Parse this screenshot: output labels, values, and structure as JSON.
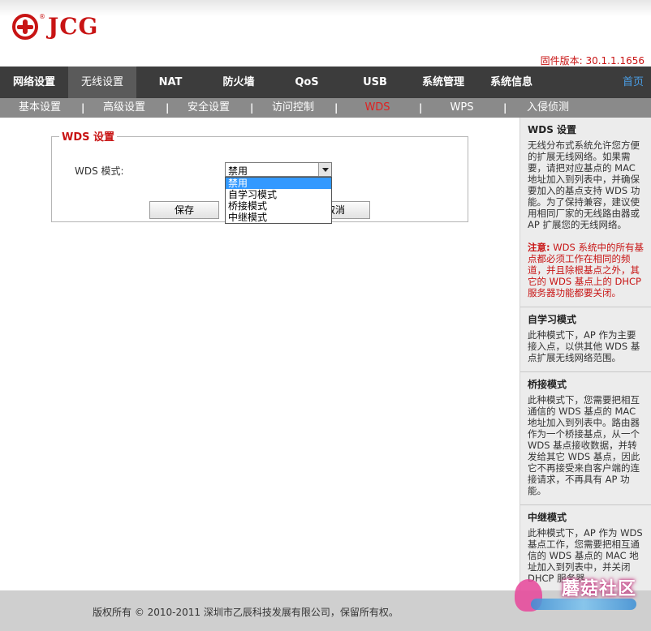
{
  "header": {
    "logo_reg": "®",
    "logo_text": "JCG",
    "firmware": "固件版本: 30.1.1.1656"
  },
  "mainnav": {
    "items": [
      "网络设置",
      "无线设置",
      "NAT",
      "防火墙",
      "QoS",
      "USB",
      "系统管理",
      "系统信息"
    ],
    "active_index": 1,
    "home": "首页"
  },
  "subnav": {
    "items": [
      "基本设置",
      "高级设置",
      "安全设置",
      "访问控制",
      "WDS",
      "WPS",
      "入侵侦测"
    ],
    "active_index": 4,
    "separator": "|"
  },
  "form": {
    "legend": "WDS 设置",
    "mode_label": "WDS 模式:",
    "selected": "禁用",
    "options": [
      "禁用",
      "自学习模式",
      "桥接模式",
      "中继模式"
    ],
    "save": "保存",
    "cancel": "取消"
  },
  "help": {
    "wds_title": "WDS 设置",
    "wds_text": "无线分布式系统允许您方便的扩展无线网络。如果需要，请把对应基点的 MAC 地址加入到列表中，并确保要加入的基点支持 WDS 功能。为了保持兼容，建议使用相同厂家的无线路由器或 AP 扩展您的无线网络。",
    "note_label": "注意:",
    "note_text": " WDS 系统中的所有基点都必须工作在相同的频道，并且除根基点之外，其它的 WDS 基点上的 DHCP 服务器功能都要关闭。",
    "auto_title": "自学习模式",
    "auto_text": "此种模式下，AP 作为主要接入点，以供其他 WDS 基点扩展无线网络范围。",
    "bridge_title": "桥接模式",
    "bridge_text": "此种模式下，您需要把相互通信的 WDS 基点的 MAC 地址加入到列表中。路由器作为一个桥接基点，从一个 WDS 基点接收数据，并转发给其它 WDS 基点，因此它不再接受来自客户端的连接请求，不再具有 AP 功能。",
    "repeater_title": "中继模式",
    "repeater_text": "此种模式下，AP 作为 WDS 基点工作，您需要把相互通信的 WDS 基点的 MAC 地址加入到列表中，并关闭 DHCP 服务器。"
  },
  "footer": {
    "copyright": "版权所有 © 2010-2011 深圳市乙辰科技发展有限公司，保留所有权。",
    "watermark": "蘑菇社区"
  }
}
